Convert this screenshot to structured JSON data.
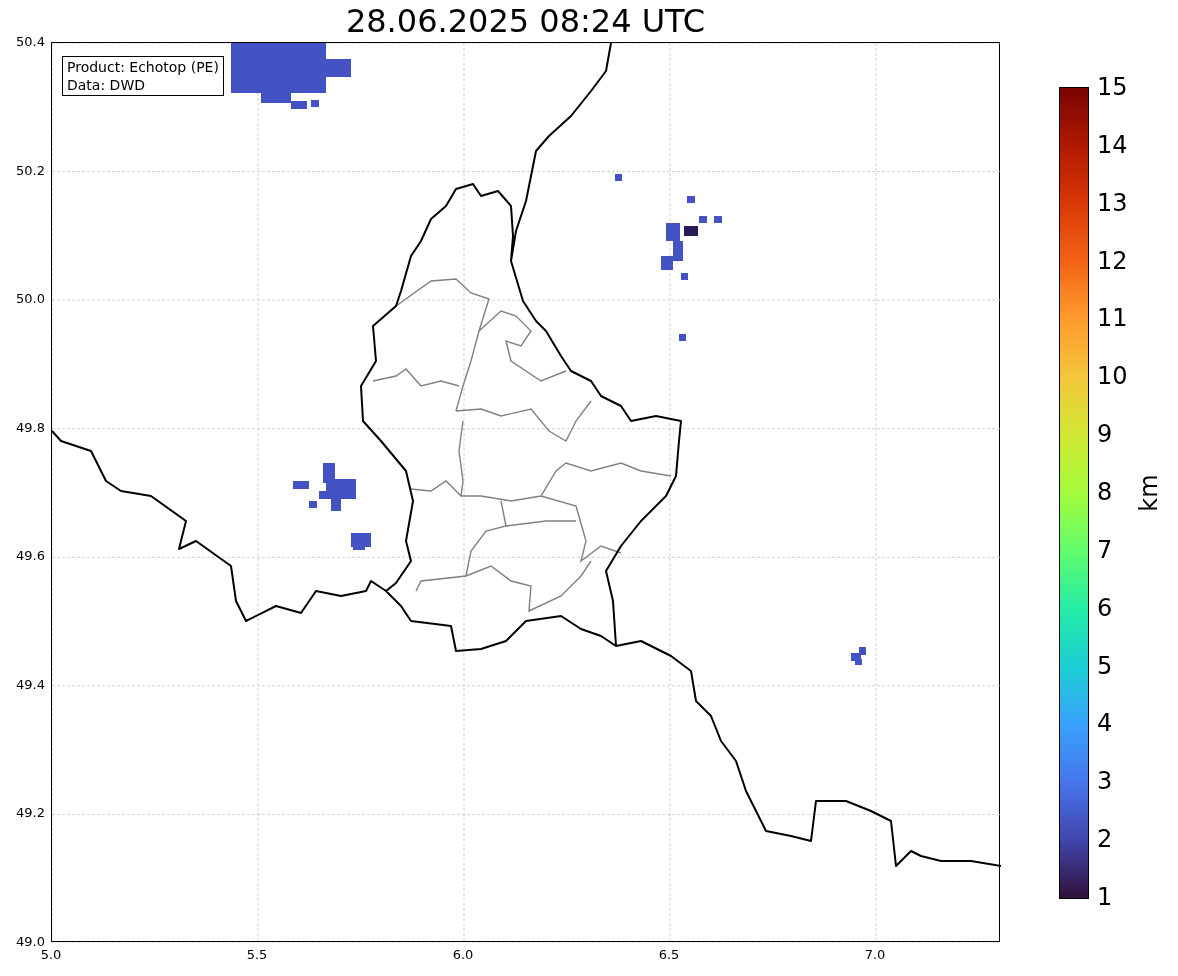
{
  "figure": {
    "title": "28.06.2025 08:24 UTC"
  },
  "info_box": {
    "lines": [
      "Product: Echotop (PE)",
      "Data: DWD"
    ]
  },
  "x_axis": {
    "ticks": [
      "5.0",
      "5.5",
      "6.0",
      "6.5",
      "7.0"
    ]
  },
  "y_axis": {
    "ticks": [
      "50.4",
      "50.2",
      "50.0",
      "49.8",
      "49.6",
      "49.4",
      "49.2",
      "49.0"
    ]
  },
  "colorbar": {
    "label": "km",
    "ticks": [
      "15",
      "14",
      "13",
      "12",
      "11",
      "10",
      "9",
      "8",
      "7",
      "6",
      "5",
      "4",
      "3",
      "2",
      "1"
    ]
  }
}
